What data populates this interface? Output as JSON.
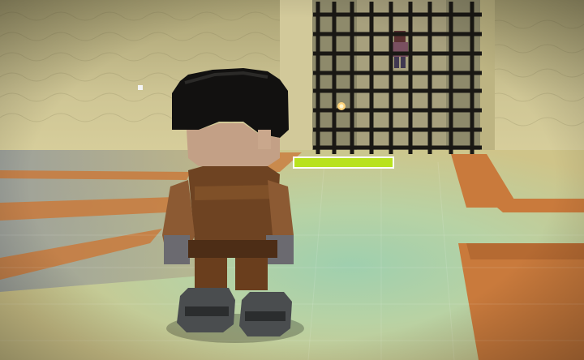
{
  "hud": {
    "health_fraction": 1.0,
    "health_color": "#b8e21e",
    "health_border_color": "#ffffff"
  },
  "scene": {
    "wall_color": "#c9c08f",
    "floor_color": "#d6cc93",
    "carpet_color": "#c97a3c",
    "gate_color": "#1a1814",
    "character_hair_color": "#111111",
    "character_armor_color": "#7a4a24"
  },
  "icons": {
    "torch_spark": "spark-icon",
    "dust_particle": "particle-icon"
  }
}
